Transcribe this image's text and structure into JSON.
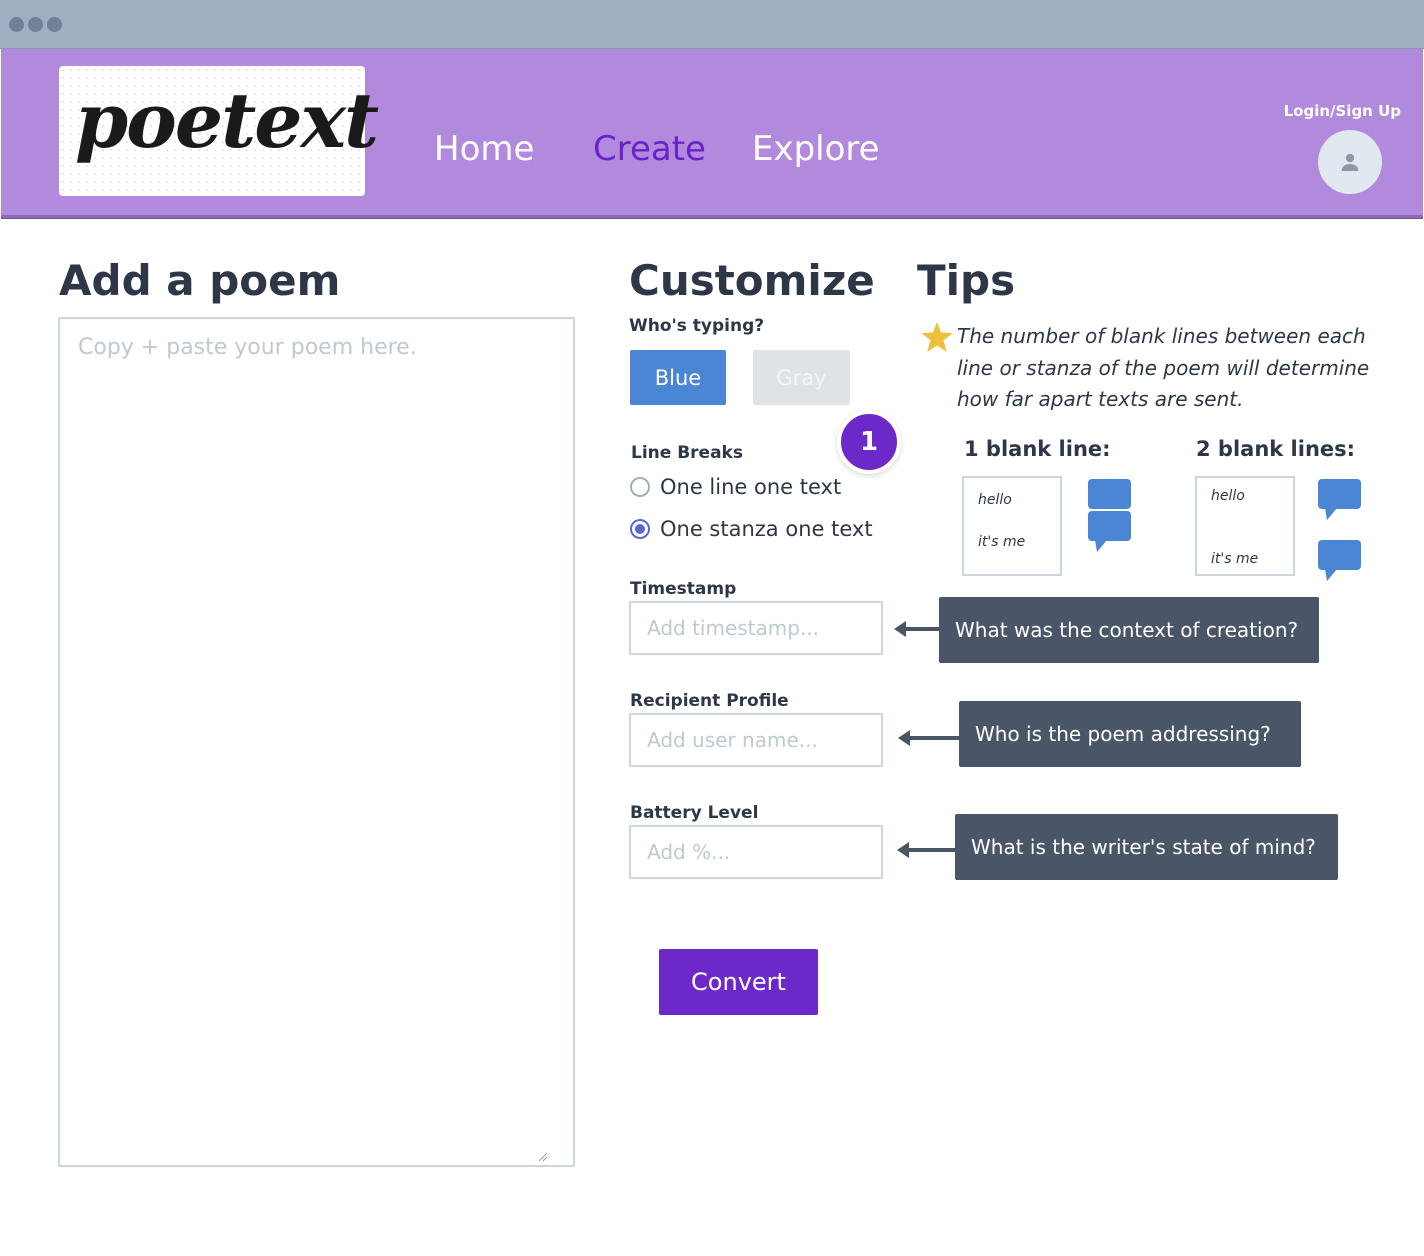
{
  "brand": {
    "logo_text": "poetext"
  },
  "nav": {
    "home": "Home",
    "create": "Create",
    "explore": "Explore",
    "login": "Login/Sign Up"
  },
  "add_poem": {
    "heading": "Add a poem",
    "placeholder": "Copy + paste your poem here."
  },
  "customize": {
    "heading": "Customize",
    "whos_typing_label": "Who's typing?",
    "blue_label": "Blue",
    "gray_label": "Gray",
    "step_badge": "1",
    "line_breaks_label": "Line Breaks",
    "options": [
      {
        "label": "One line one text",
        "selected": false
      },
      {
        "label": "One stanza one text",
        "selected": true
      }
    ],
    "timestamp": {
      "label": "Timestamp",
      "placeholder": "Add timestamp..."
    },
    "recipient": {
      "label": "Recipient Profile",
      "placeholder": "Add user name..."
    },
    "battery": {
      "label": "Battery Level",
      "placeholder": "Add %..."
    },
    "convert_label": "Convert"
  },
  "callouts": {
    "timestamp": "What was the context of creation?",
    "recipient": "Who is the poem addressing?",
    "battery": "What is the writer's state of mind?"
  },
  "tips": {
    "heading": "Tips",
    "text": "The number of blank lines between each line or stanza of the poem will determine how far apart texts are sent.",
    "example_one": {
      "label": "1 blank line:",
      "line1": "hello",
      "line2": "it's me"
    },
    "example_two": {
      "label": "2 blank lines:",
      "line1": "hello",
      "line2": "it's me"
    }
  },
  "colors": {
    "header": "#b18ade",
    "accent_purple": "#6d28c9",
    "blue_button": "#4a86d4",
    "callout": "#4a5568"
  }
}
